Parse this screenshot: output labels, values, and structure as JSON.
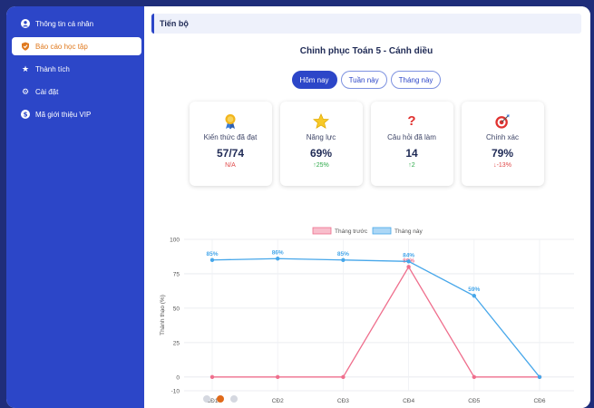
{
  "sidebar": {
    "items": [
      {
        "label": "Thông tin cá nhân",
        "icon": "user-icon",
        "active": false
      },
      {
        "label": "Báo cáo học tập",
        "icon": "shield-icon",
        "active": true
      },
      {
        "label": "Thành tích",
        "icon": "star-icon",
        "active": false
      },
      {
        "label": "Cài đặt",
        "icon": "gear-icon",
        "active": false
      },
      {
        "label": "Mã giới thiệu VIP",
        "icon": "coin-icon",
        "active": false
      }
    ]
  },
  "main": {
    "breadcrumb": "Tiến bộ",
    "course_title": "Chinh phục Toán 5 - Cánh diều",
    "tabs": [
      {
        "label": "Hôm nay",
        "active": true
      },
      {
        "label": "Tuần này",
        "active": false
      },
      {
        "label": "Tháng này",
        "active": false
      }
    ],
    "cards": [
      {
        "icon": "medal-icon",
        "label": "Kiến thức đã đạt",
        "value": "57/74",
        "delta": "N/A",
        "delta_color": "#e04848"
      },
      {
        "icon": "star-icon",
        "label": "Năng lực",
        "value": "69%",
        "delta": "↑25%",
        "delta_color": "#2eaa4a"
      },
      {
        "icon": "question-icon",
        "label": "Câu hỏi đã làm",
        "value": "14",
        "delta": "↑2",
        "delta_color": "#2eaa4a"
      },
      {
        "icon": "target-icon",
        "label": "Chính xác",
        "value": "79%",
        "delta": "↓-13%",
        "delta_color": "#e04848"
      }
    ],
    "carousel": {
      "count": 3,
      "active": 1
    }
  },
  "colors": {
    "accent": "#2c46c8",
    "active_text": "#e07a1f",
    "last_month": "#ef6f8d",
    "this_month": "#47a7ea"
  },
  "chart_data": {
    "type": "line",
    "categories": [
      "CĐ1",
      "CĐ2",
      "CĐ3",
      "CĐ4",
      "CĐ5",
      "CĐ6"
    ],
    "series": [
      {
        "name": "Tháng trước",
        "color": "#ef6f8d",
        "values": [
          0,
          0,
          0,
          80,
          0,
          0
        ],
        "labels": [
          "",
          "",
          "",
          "80%",
          "",
          ""
        ]
      },
      {
        "name": "Tháng này",
        "color": "#47a7ea",
        "values": [
          85,
          86,
          85,
          84,
          59,
          0
        ],
        "labels": [
          "85%",
          "86%",
          "85%",
          "84%",
          "59%",
          ""
        ]
      }
    ],
    "ylabel": "Thành thạo (%)",
    "ylim": [
      -10,
      100
    ],
    "yticks": [
      100,
      75,
      50,
      25,
      0,
      -10
    ],
    "grid": true,
    "legend": "top-center"
  }
}
